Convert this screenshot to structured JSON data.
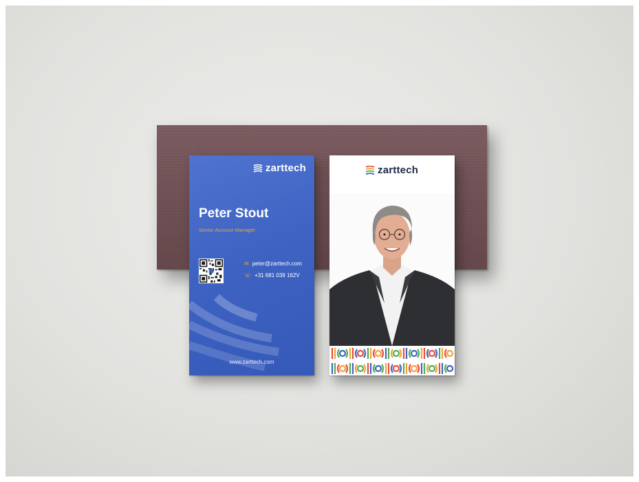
{
  "front_card": {
    "brand": "zarttech",
    "name": "Peter Stout",
    "role": "Senior Account Manager",
    "email": "peter@zarttech.com",
    "phone": "+31 681 039 162V",
    "website": "www.zarttech.com",
    "icons": {
      "email": "mail-icon",
      "phone": "phone-icon",
      "qr": "qr-code"
    }
  },
  "back_card": {
    "brand": "zarttech",
    "photo": "portrait-photo"
  },
  "colors": {
    "card_blue": "#3e63c2",
    "accent_orange": "#f2a23a",
    "plank": "#6f5054",
    "background": "#e2e2df"
  }
}
